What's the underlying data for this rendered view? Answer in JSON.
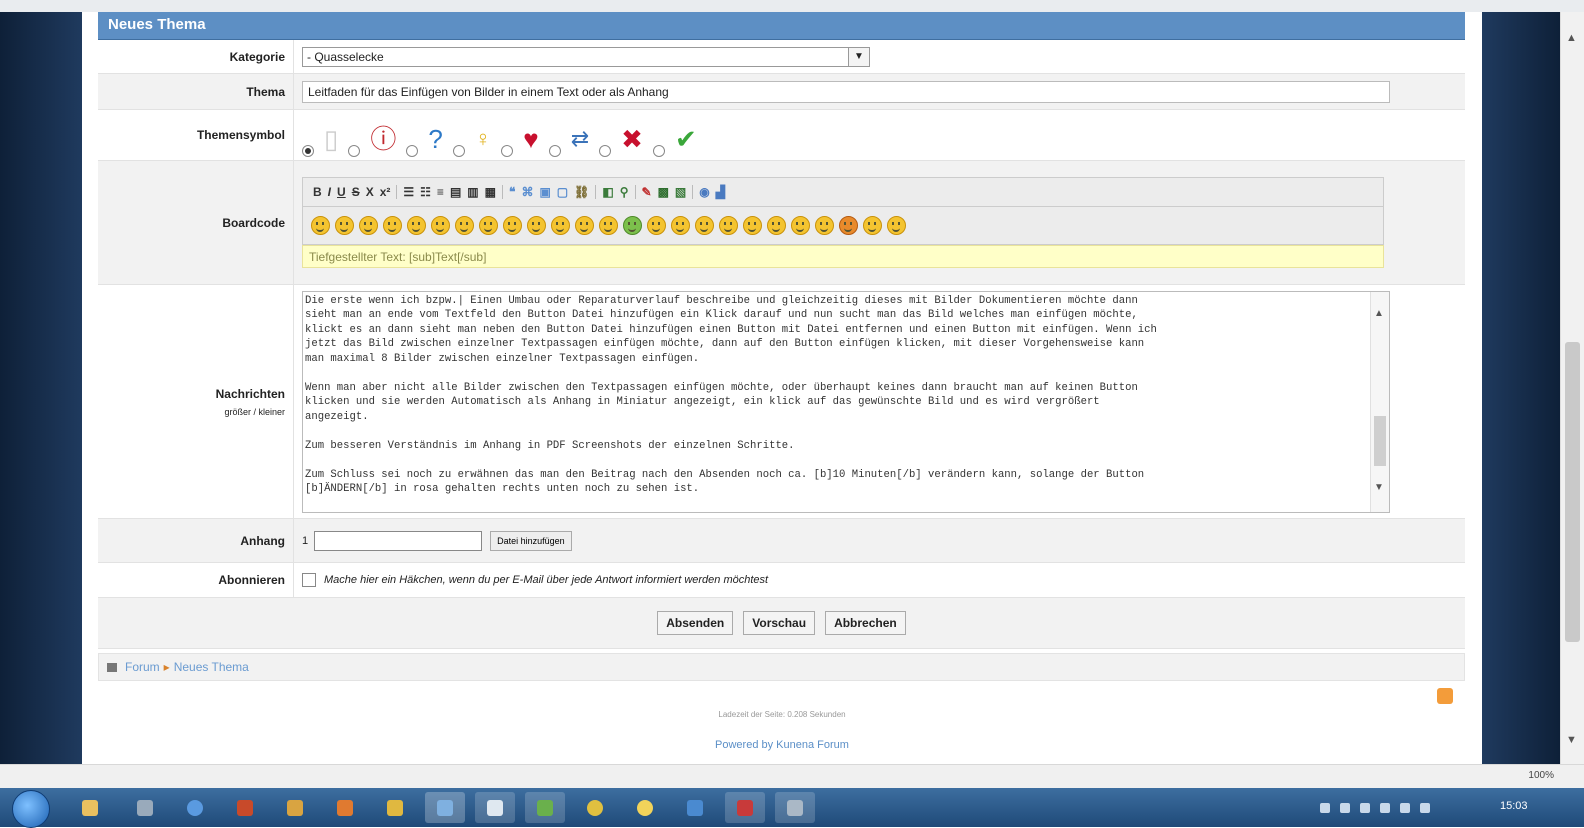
{
  "form": {
    "header": "Neues Thema",
    "labels": {
      "kategorie": "Kategorie",
      "thema": "Thema",
      "themensymbol": "Themensymbol",
      "boardcode": "Boardcode",
      "nachrichten": "Nachrichten",
      "nachrichten_sub": "größer / kleiner",
      "anhang": "Anhang",
      "abonnieren": "Abonnieren"
    },
    "kategorie_value": "- Quasselecke",
    "thema_value": "Leitfaden für das Einfügen von Bilder in einem Text oder als Anhang",
    "boardcode_help": "Tiefgestellter Text: [sub]Text[/sub]",
    "toolbar_labels": [
      "B",
      "I",
      "U",
      "S",
      "X",
      "x²"
    ],
    "message": "Die erste wenn ich bzpw.| Einen Umbau oder Reparaturverlauf beschreibe und gleichzeitig dieses mit Bilder Dokumentieren möchte dann\nsieht man an ende vom Textfeld den Button Datei hinzufügen ein Klick darauf und nun sucht man das Bild welches man einfügen möchte,\nklickt es an dann sieht man neben den Button Datei hinzufügen einen Button mit Datei entfernen und einen Button mit einfügen. Wenn ich\njetzt das Bild zwischen einzelner Textpassagen einfügen möchte, dann auf den Button einfügen klicken, mit dieser Vorgehensweise kann\nman maximal 8 Bilder zwischen einzelner Textpassagen einfügen.\n\nWenn man aber nicht alle Bilder zwischen den Textpassagen einfügen möchte, oder überhaupt keines dann braucht man auf keinen Button\nklicken und sie werden Automatisch als Anhang in Miniatur angezeigt, ein klick auf das gewünschte Bild und es wird vergrößert\nangezeigt.\n\nZum besseren Verständnis im Anhang in PDF Screenshots der einzelnen Schritte.\n\nZum Schluss sei noch zu erwähnen das man den Beitrag nach den Absenden noch ca. [b]10 Minuten[/b] verändern kann, solange der Button\n[b]ÄNDERN[/b] in rosa gehalten rechts unten noch zu sehen ist.",
    "anhang_number": "1",
    "file_button": "Datei hinzufügen",
    "abonnieren_text": "Mache hier ein Häkchen, wenn du per E-Mail über jede Antwort informiert werden möchtest",
    "buttons": {
      "submit": "Absenden",
      "preview": "Vorschau",
      "cancel": "Abbrechen"
    }
  },
  "breadcrumb": {
    "forum": "Forum",
    "current": "Neues Thema"
  },
  "footer": {
    "load_time": "Ladezeit der Seite: 0.208 Sekunden",
    "powered": "Powered by Kunena Forum"
  },
  "browser": {
    "zoom": "100%"
  },
  "taskbar": {
    "clock": "15:03"
  },
  "colors": {
    "header_blue": "#5d8fc4",
    "link_blue": "#5b8fc7",
    "helpline_yellow": "#ffffc8"
  }
}
